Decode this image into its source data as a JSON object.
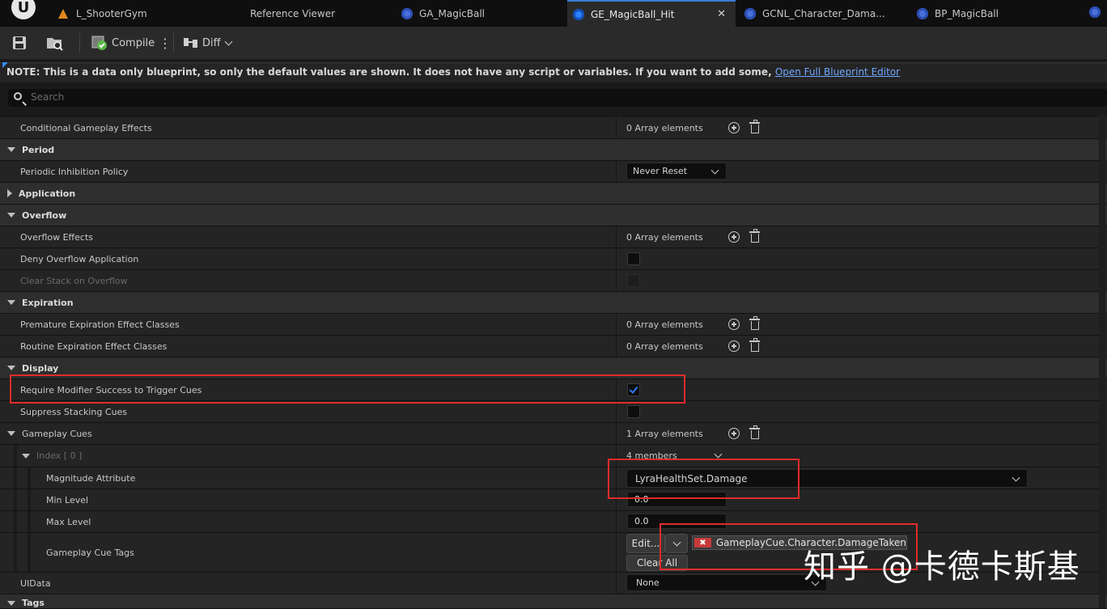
{
  "tabs": [
    {
      "label": "L_ShooterGym",
      "icon": "level-icon"
    },
    {
      "label": "Reference Viewer",
      "icon": ""
    },
    {
      "label": "GA_MagicBall",
      "icon": "blueprint-icon"
    },
    {
      "label": "GE_MagicBall_Hit",
      "icon": "gameplay-effect-icon",
      "active": true
    },
    {
      "label": "GCNL_Character_Dama...",
      "icon": "blueprint-icon"
    },
    {
      "label": "BP_MagicBall",
      "icon": "blueprint-icon"
    }
  ],
  "toolbar": {
    "compile_label": "Compile",
    "diff_label": "Diff"
  },
  "note": {
    "text": "NOTE: This is a data only blueprint, so only the default values are shown.  It does not have any script or variables.  If you want to add some, ",
    "link": "Open Full Blueprint Editor"
  },
  "search": {
    "placeholder": "Search"
  },
  "rows": {
    "conditional_effects": {
      "name": "Conditional Gameplay Effects",
      "value": "0 Array elements"
    },
    "period": {
      "name": "Period"
    },
    "periodic_inhibition": {
      "name": "Periodic Inhibition Policy",
      "value": "Never Reset"
    },
    "application": {
      "name": "Application"
    },
    "overflow": {
      "name": "Overflow"
    },
    "overflow_effects": {
      "name": "Overflow Effects",
      "value": "0 Array elements"
    },
    "deny_overflow": {
      "name": "Deny Overflow Application"
    },
    "clear_stack": {
      "name": "Clear Stack on Overflow"
    },
    "expiration": {
      "name": "Expiration"
    },
    "premature": {
      "name": "Premature Expiration Effect Classes",
      "value": "0 Array elements"
    },
    "routine": {
      "name": "Routine Expiration Effect Classes",
      "value": "0 Array elements"
    },
    "display": {
      "name": "Display"
    },
    "require_modifier": {
      "name": "Require Modifier Success to Trigger Cues",
      "checked": true
    },
    "suppress_stacking": {
      "name": "Suppress Stacking Cues",
      "checked": false
    },
    "gameplay_cues": {
      "name": "Gameplay Cues",
      "value": "1 Array elements"
    },
    "index0": {
      "name": "Index [ 0 ]",
      "value": "4 members"
    },
    "magnitude_attribute": {
      "name": "Magnitude Attribute",
      "value": "LyraHealthSet.Damage"
    },
    "min_level": {
      "name": "Min Level",
      "value": "0.0"
    },
    "max_level": {
      "name": "Max Level",
      "value": "0.0"
    },
    "cue_tags": {
      "name": "Gameplay Cue Tags",
      "edit_label": "Edit...",
      "clear_label": "Clear All",
      "tag": "GameplayCue.Character.DamageTaken"
    },
    "uidata": {
      "name": "UIData",
      "value": "None"
    },
    "tags": {
      "name": "Tags"
    }
  },
  "watermark": "知乎 @卡德卡斯基",
  "colors": {
    "accent": "#2c82ff",
    "highlight": "#e02b2b",
    "link": "#6fa8ff"
  }
}
